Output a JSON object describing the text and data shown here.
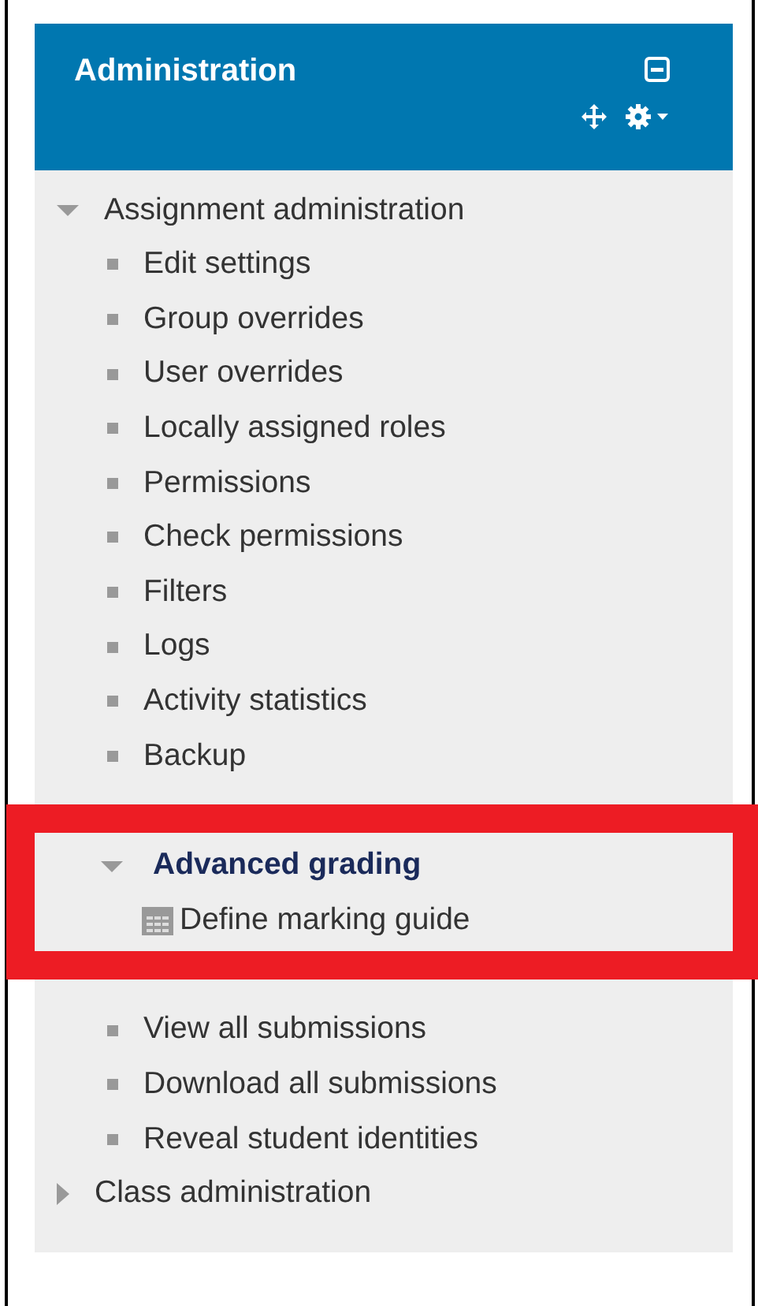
{
  "block": {
    "title": "Administration"
  },
  "tree": [
    {
      "label": "Assignment administration",
      "expanded": true,
      "children": [
        {
          "label": "Edit settings"
        },
        {
          "label": "Group overrides"
        },
        {
          "label": "User overrides"
        },
        {
          "label": "Locally assigned roles"
        },
        {
          "label": "Permissions"
        },
        {
          "label": "Check permissions"
        },
        {
          "label": "Filters"
        },
        {
          "label": "Logs"
        },
        {
          "label": "Activity statistics"
        },
        {
          "label": "Backup"
        },
        {
          "label": "Advanced grading",
          "expanded": true,
          "highlighted": true,
          "children": [
            {
              "label": "Define marking guide",
              "kind": "page"
            }
          ]
        },
        {
          "label": "View all submissions"
        },
        {
          "label": "Download all submissions"
        },
        {
          "label": "Reveal student identities"
        }
      ]
    },
    {
      "label": "Class administration",
      "expanded": false
    }
  ]
}
